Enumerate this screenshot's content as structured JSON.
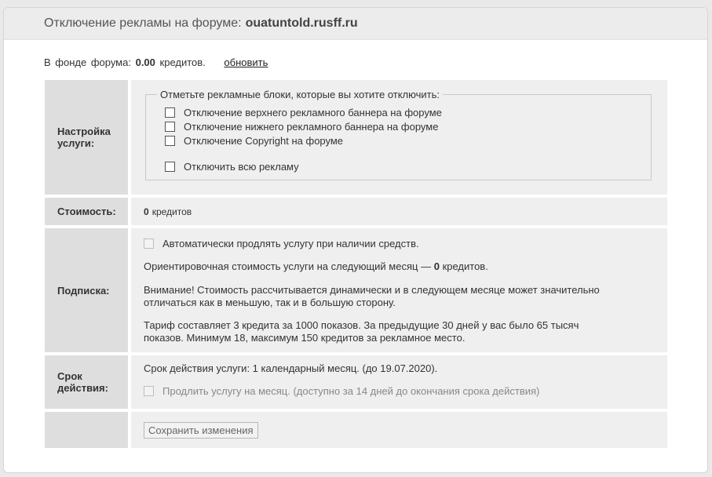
{
  "header": {
    "title": "Отключение рекламы на форуме:",
    "domain": "ouatuntold.rusff.ru"
  },
  "balance": {
    "prefix": "В фонде форума:",
    "amount": "0.00",
    "unit": "кредитов.",
    "refresh_label": "обновить"
  },
  "service_settings": {
    "label": "Настройка услуги:",
    "legend": "Отметьте рекламные блоки, которые вы хотите отключить:",
    "options": [
      {
        "label": "Отключение верхнего рекламного баннера на форуме",
        "checked": false
      },
      {
        "label": "Отключение нижнего рекламного баннера на форуме",
        "checked": false
      },
      {
        "label": "Отключение Copyright на форуме",
        "checked": false
      }
    ],
    "disable_all_label": "Отключить всю рекламу"
  },
  "cost": {
    "label": "Стоимость:",
    "amount": "0",
    "unit": "кредитов"
  },
  "subscription": {
    "label": "Подписка:",
    "auto_renew_label": "Автоматически продлять услугу при наличии средств.",
    "next_month_prefix": "Ориентировочная стоимость услуги на следующий месяц —",
    "next_month_amount": "0",
    "next_month_unit": "кредитов.",
    "warning_line1": "Внимание! Стоимость рассчитывается динамически и в следующем месяце может значительно",
    "warning_line2": "отличаться как в меньшую, так и в большую сторону.",
    "tariff_line1": "Тариф составляет 3 кредита за 1000 показов. За предыдущие 30 дней у вас было 65 тысяч",
    "tariff_line2": "показов. Минимум 18, максимум 150 кредитов за рекламное место."
  },
  "validity": {
    "label": "Срок действия:",
    "period_text": "Срок действия услуги: 1 календарный месяц. (до 19.07.2020).",
    "extend_label": "Продлить услугу на месяц. (доступно за 14 дней до окончания срока действия)"
  },
  "actions": {
    "save_label": "Сохранить изменения"
  },
  "colors": {
    "cost_green": "#2e8b2e",
    "label_bg": "#dedede",
    "value_bg": "#efefef"
  }
}
